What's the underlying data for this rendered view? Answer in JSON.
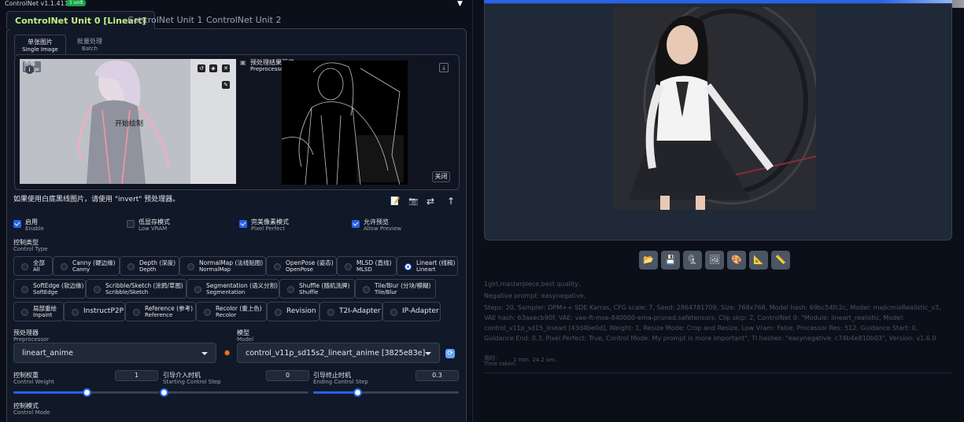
{
  "header": {
    "title": "ControlNet v1.1.411",
    "badge": "1 unit"
  },
  "unit_tabs": [
    "ControlNet Unit 0 [Lineart]",
    "ControlNet Unit 1",
    "ControlNet Unit 2"
  ],
  "image_tabs": [
    {
      "zh": "单张图片",
      "en": "Single Image"
    },
    {
      "zh": "批量处理",
      "en": "Batch"
    }
  ],
  "image_panel": {
    "label_zh": "图像",
    "label_en": "Image",
    "overlay_text": "开始绘制"
  },
  "preview_panel": {
    "label_zh": "预处理结果预览",
    "label_en": "Preprocessor Preview",
    "close_label": "关闭"
  },
  "hint": "如果使用白底黑线图片，请使用 \"invert\" 预处理器。",
  "toggles": [
    {
      "zh": "启用",
      "en": "Enable",
      "checked": true
    },
    {
      "zh": "低显存模式",
      "en": "Low VRAM",
      "checked": false
    },
    {
      "zh": "完美像素模式",
      "en": "Pixel Perfect",
      "checked": true
    },
    {
      "zh": "允许预览",
      "en": "Allow Preview",
      "checked": true
    }
  ],
  "control_type": {
    "label_zh": "控制类型",
    "label_en": "Control Type",
    "options": [
      {
        "zh": "全部",
        "en": "All"
      },
      {
        "zh": "Canny (硬边缘)",
        "en": "Canny"
      },
      {
        "zh": "Depth (深度)",
        "en": "Depth"
      },
      {
        "zh": "NormalMap (法线贴图)",
        "en": "NormalMap"
      },
      {
        "zh": "OpenPose (姿态)",
        "en": "OpenPose"
      },
      {
        "zh": "MLSD (直线)",
        "en": "MLSD"
      },
      {
        "zh": "Lineart (线稿)",
        "en": "Lineart",
        "selected": true
      },
      {
        "zh": "SoftEdge (软边缘)",
        "en": "SoftEdge"
      },
      {
        "zh": "Scribble/Sketch (涂鸦/草图)",
        "en": "Scribble/Sketch"
      },
      {
        "zh": "Segmentation (语义分割)",
        "en": "Segmentation"
      },
      {
        "zh": "Shuffle (随机洗牌)",
        "en": "Shuffle"
      },
      {
        "zh": "Tile/Blur (分块/模糊)",
        "en": "Tile/Blur"
      },
      {
        "zh": "局部重绘",
        "en": "Inpaint"
      },
      {
        "zh": "InstructP2P",
        "en": ""
      },
      {
        "zh": "Reference (参考)",
        "en": "Reference"
      },
      {
        "zh": "Recolor (重上色)",
        "en": "Recolor"
      },
      {
        "zh": "Revision",
        "en": ""
      },
      {
        "zh": "T2I-Adapter",
        "en": ""
      },
      {
        "zh": "IP-Adapter",
        "en": ""
      }
    ]
  },
  "preprocessor": {
    "label_zh": "预处理器",
    "label_en": "Preprocessor",
    "value": "lineart_anime"
  },
  "model": {
    "label_zh": "模型",
    "label_en": "Model",
    "value": "control_v11p_sd15s2_lineart_anime [3825e83e]"
  },
  "sliders": [
    {
      "zh": "控制权重",
      "en": "Control Weight",
      "value": "1",
      "fraction": 0.5
    },
    {
      "zh": "引导介入时机",
      "en": "Starting Control Step",
      "value": "0",
      "fraction": 0.0
    },
    {
      "zh": "引导终止时机",
      "en": "Ending Control Step",
      "value": "0.3",
      "fraction": 0.3
    }
  ],
  "control_mode": {
    "label_zh": "控制模式",
    "label_en": "Control Mode"
  },
  "output": {
    "tools": [
      "folder-icon",
      "save-icon",
      "zip-icon",
      "image-icon",
      "palette-icon",
      "triangle-ruler-icon",
      "ruler-icon"
    ],
    "prompt": "1girl,masterpiece,best quality,",
    "negative": "Negative prompt: easynegative,",
    "params": "Steps: 20, Sampler: DPM++ SDE Karras, CFG scale: 7, Seed: 2864781709, Size: 768x768, Model hash: 69bc54fc2c, Model: majicmixRealistic_v3, VAE hash: 63aeecb90f, VAE: vae-ft-mse-840000-ema-pruned.safetensors, Clip skip: 2, ControlNet 0: \"Module: lineart_realistic, Model: control_v11p_sd15_lineart [43d4be0d], Weight: 1, Resize Mode: Crop and Resize, Low Vram: False, Processor Res: 512, Guidance Start: 0, Guidance End: 0.3, Pixel Perfect: True, Control Mode: My prompt is more important\", TI hashes: \"easynegative: c74b4e810b03\", Version: v1.6.0",
    "time_label_zh": "用时:",
    "time_label_en": "Time taken:",
    "time_value": "1 min. 24.2 sec."
  },
  "colors": {
    "accent": "#2563eb",
    "tab_active": "#c3f07f",
    "bg": "#0b0f19"
  }
}
